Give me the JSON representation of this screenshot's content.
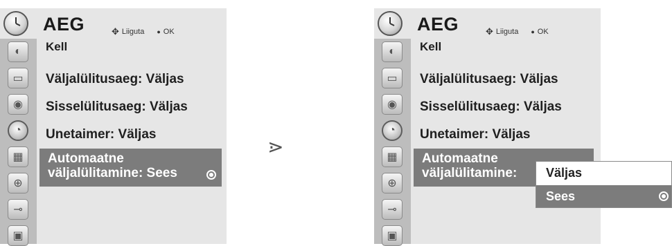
{
  "header": {
    "title": "AEG",
    "nav_hint": "Liiguta",
    "ok_label": "OK"
  },
  "sidebar": {
    "icons": [
      "satellite-icon",
      "monitor-icon",
      "speaker-icon",
      "clock-icon",
      "calendar-icon",
      "lock-icon",
      "cable-icon",
      "picture-icon"
    ]
  },
  "menu": {
    "items": [
      "Kell",
      "Väljalülitusaeg: Väljas",
      "Sisselülitusaeg: Väljas",
      "Unetaimer: Väljas"
    ],
    "selected_line1": "Automaatne",
    "selected_line2_left": "väljalülitamine:  Sees",
    "selected_line2_right": "väljalülitamine:"
  },
  "transition": ">",
  "dropdown": {
    "options": [
      "Väljas",
      "Sees"
    ],
    "selected": "Sees"
  }
}
